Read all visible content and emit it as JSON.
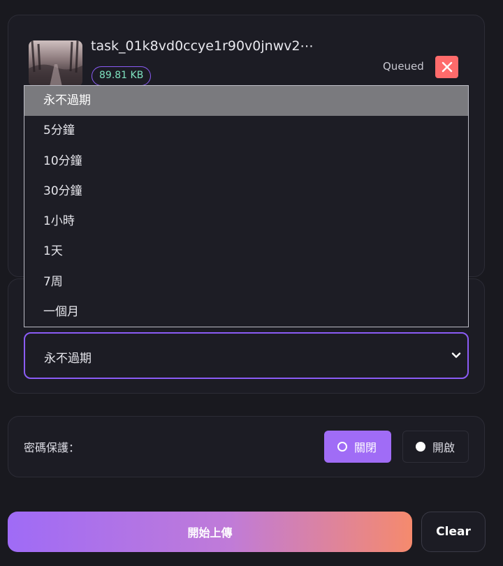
{
  "file": {
    "name": "task_01k8vd0ccye1r90v0jnwv2⋯",
    "size": "89.81 KB",
    "status": "Queued"
  },
  "expiry": {
    "selected": "永不過期",
    "options": [
      "永不過期",
      "5分鐘",
      "10分鐘",
      "30分鐘",
      "1小時",
      "1天",
      "7周",
      "一個月"
    ]
  },
  "password": {
    "label": "密碼保護：",
    "off_label": "關閉",
    "on_label": "開啟"
  },
  "actions": {
    "start_label": "開始上傳",
    "clear_label": "Clear"
  },
  "colors": {
    "accent": "#8b5cf6",
    "danger": "#ff6b6b",
    "size_text": "#7fe3c0"
  }
}
